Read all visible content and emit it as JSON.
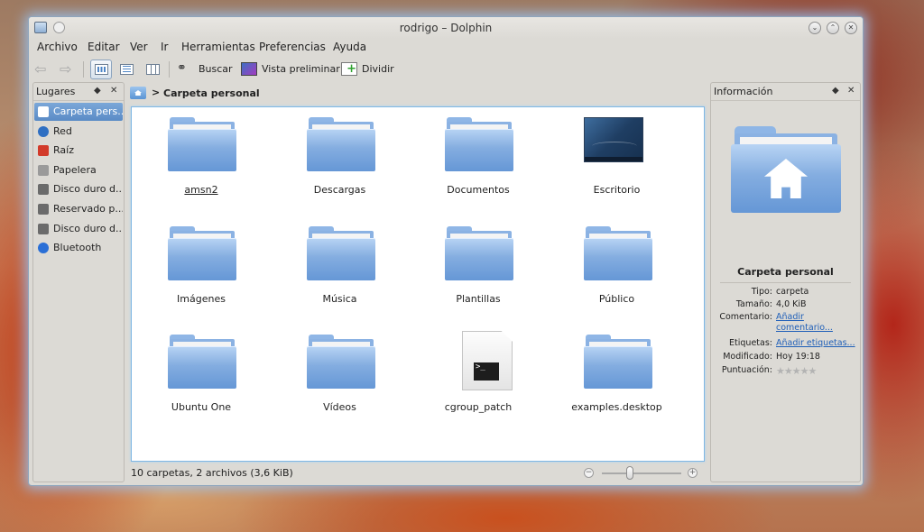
{
  "window": {
    "title": "rodrigo – Dolphin"
  },
  "menu": [
    "Archivo",
    "Editar",
    "Ver",
    "Ir",
    "Herramientas",
    "Preferencias",
    "Ayuda"
  ],
  "toolbar": {
    "search_label": "Buscar",
    "preview_label": "Vista preliminar",
    "split_label": "Dividir"
  },
  "places": {
    "title": "Lugares",
    "items": [
      {
        "label": "Carpeta pers...",
        "icon": "home-icon",
        "selected": true,
        "color": "#5a8bc6"
      },
      {
        "label": "Red",
        "icon": "network-icon",
        "color": "#2f6fc2"
      },
      {
        "label": "Raíz",
        "icon": "root-folder-icon",
        "color": "#d23a2a"
      },
      {
        "label": "Papelera",
        "icon": "trash-icon",
        "color": "#9a9a9a"
      },
      {
        "label": "Disco duro d...",
        "icon": "harddisk-icon",
        "color": "#6b6b6b"
      },
      {
        "label": "Reservado p...",
        "icon": "harddisk-icon",
        "color": "#6b6b6b"
      },
      {
        "label": "Disco duro d...",
        "icon": "harddisk-icon",
        "color": "#6b6b6b"
      },
      {
        "label": "Bluetooth",
        "icon": "bluetooth-icon",
        "color": "#2a6fd6"
      }
    ]
  },
  "breadcrumb": {
    "current": "Carpeta personal"
  },
  "files": [
    {
      "name": "amsn2",
      "type": "folder"
    },
    {
      "name": "Descargas",
      "type": "folder"
    },
    {
      "name": "Documentos",
      "type": "folder"
    },
    {
      "name": "Escritorio",
      "type": "desktop"
    },
    {
      "name": "Imágenes",
      "type": "folder"
    },
    {
      "name": "Música",
      "type": "folder"
    },
    {
      "name": "Plantillas",
      "type": "folder"
    },
    {
      "name": "Público",
      "type": "folder"
    },
    {
      "name": "Ubuntu One",
      "type": "folder"
    },
    {
      "name": "Vídeos",
      "type": "folder"
    },
    {
      "name": "cgroup_patch",
      "type": "script",
      "terminal_text": ">_"
    },
    {
      "name": "examples.desktop",
      "type": "folder"
    }
  ],
  "status": {
    "text": "10 carpetas, 2 archivos (3,6 KiB)",
    "zoom_level": 0.35
  },
  "info": {
    "title": "Información",
    "name": "Carpeta personal",
    "rows": [
      {
        "key": "Tipo:",
        "value": "carpeta"
      },
      {
        "key": "Tamaño:",
        "value": "4,0 KiB"
      },
      {
        "key": "Comentario:",
        "value": "Añadir comentario...",
        "link": true
      },
      {
        "key": "Etiquetas:",
        "value": "Añadir etiquetas...",
        "link": true
      },
      {
        "key": "Modificado:",
        "value": "Hoy 19:18"
      },
      {
        "key": "Puntuación:",
        "value": "",
        "stars": "★★★★★",
        "rating": 0
      }
    ]
  }
}
